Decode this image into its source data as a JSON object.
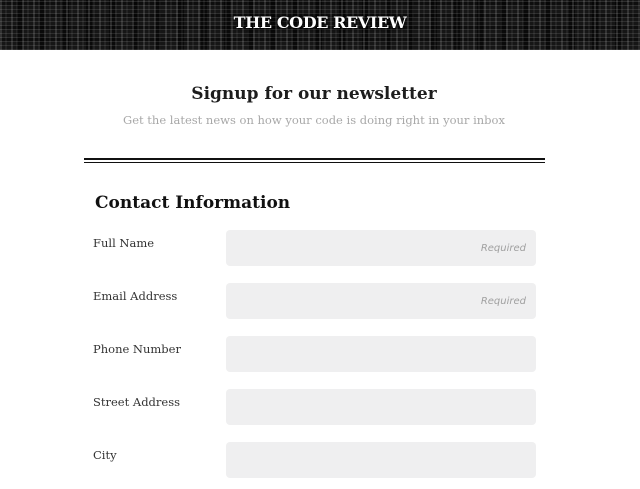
{
  "header": {
    "brand": "THE CODE REVIEW"
  },
  "newsletter": {
    "title": "Signup for our newsletter",
    "subtitle": "Get the latest news on how your code is doing right in your inbox"
  },
  "form": {
    "section_title": "Contact Information",
    "fields": [
      {
        "label": "Full Name",
        "value": "",
        "placeholder": "Required"
      },
      {
        "label": "Email Address",
        "value": "",
        "placeholder": "Required"
      },
      {
        "label": "Phone Number",
        "value": "",
        "placeholder": ""
      },
      {
        "label": "Street Address",
        "value": "",
        "placeholder": ""
      },
      {
        "label": "City",
        "value": "",
        "placeholder": ""
      }
    ]
  }
}
